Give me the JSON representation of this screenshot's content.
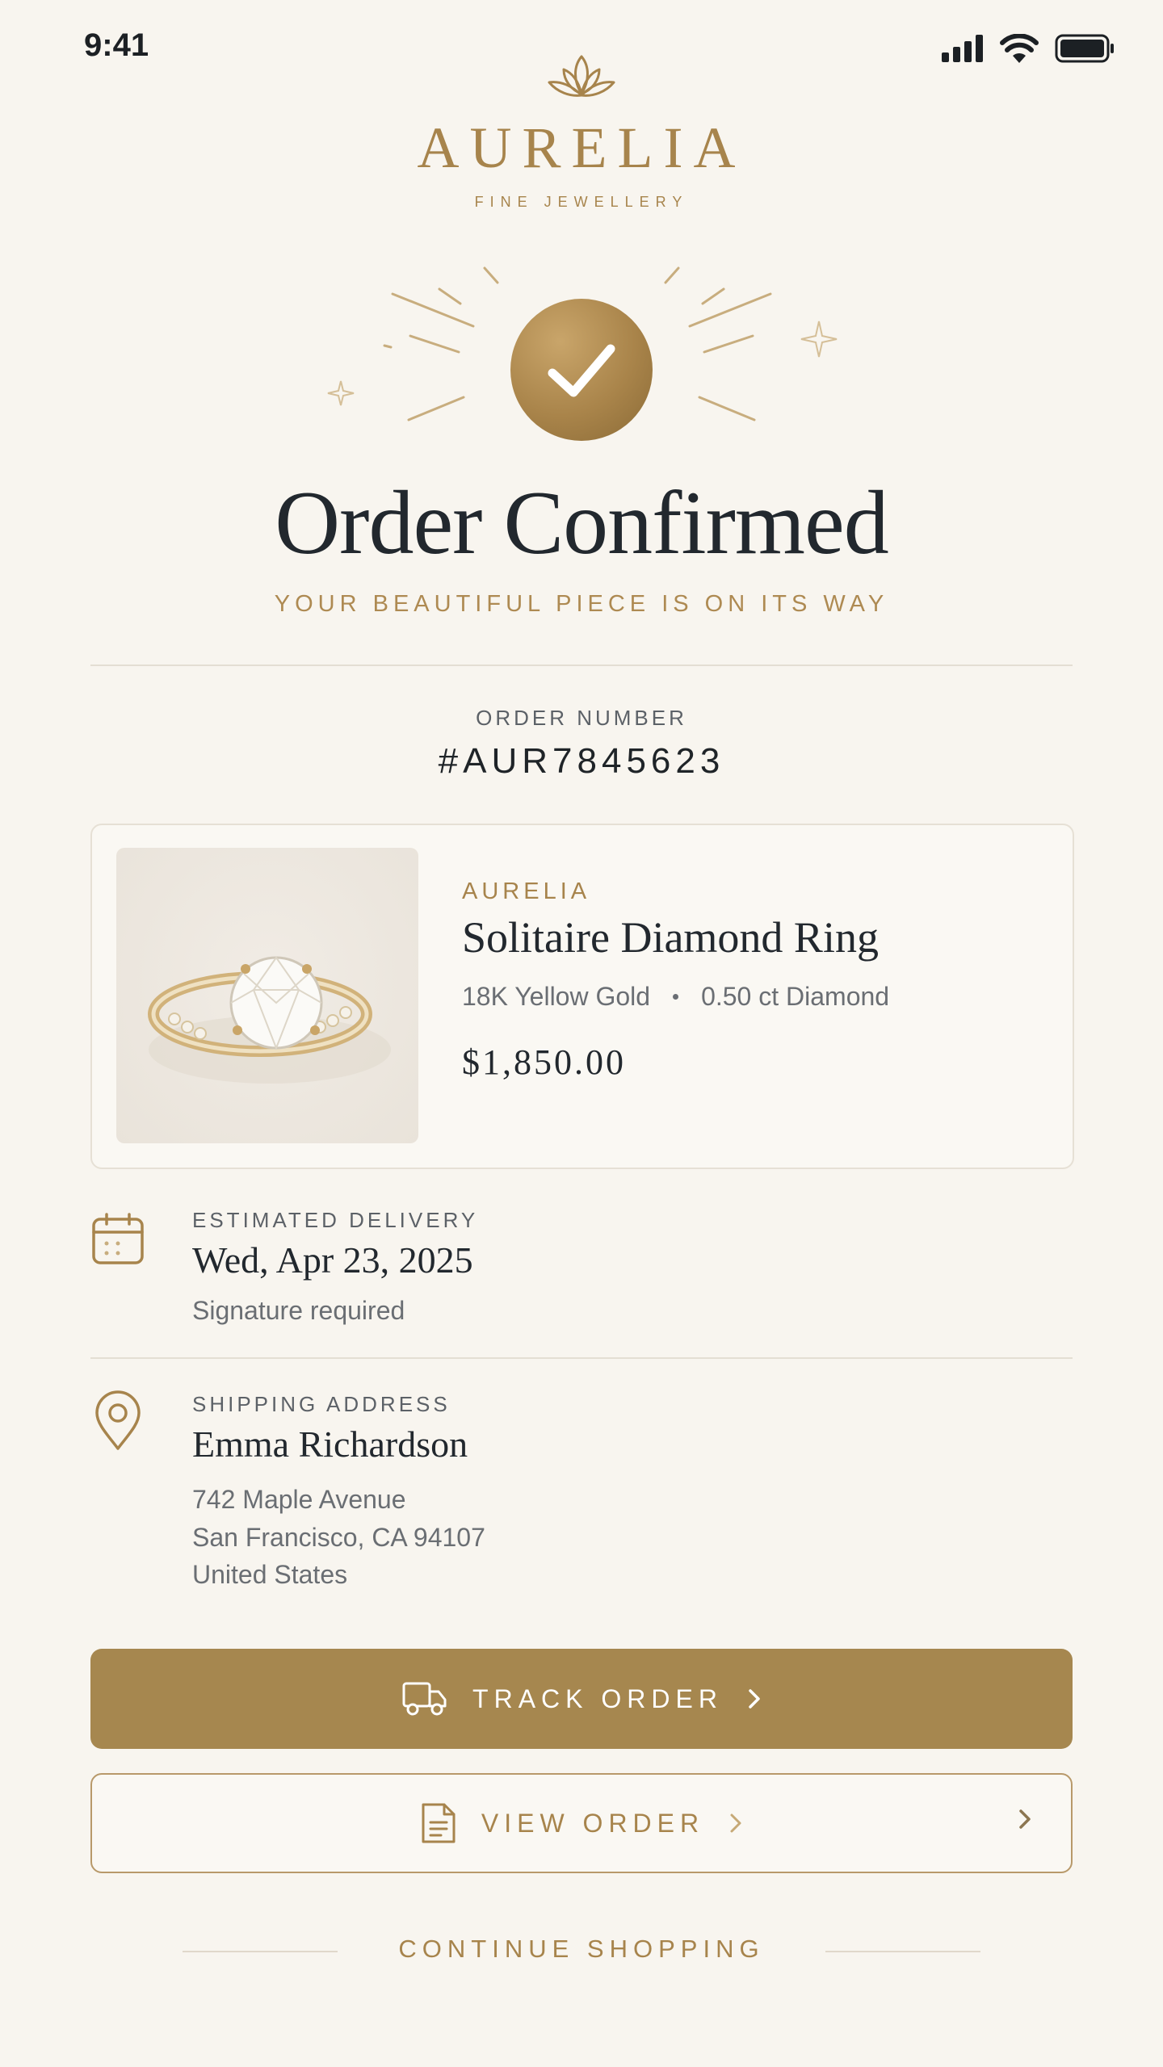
{
  "status_bar": {
    "time": "9:41"
  },
  "brand": {
    "name": "AURELIA",
    "tagline": "FINE JEWELLERY",
    "logo_icon": "lotus-icon",
    "accent_color": "#a7844c"
  },
  "confirmation": {
    "icon": "check-icon",
    "title": "Order Confirmed",
    "subtitle": "YOUR BEAUTIFUL PIECE IS ON ITS WAY"
  },
  "order": {
    "label": "ORDER NUMBER",
    "number": "#AUR7845623"
  },
  "product": {
    "brand": "AURELIA",
    "name": "Solitaire Diamond Ring",
    "metal": "18K Yellow Gold",
    "stone": "0.50 ct Diamond",
    "price": "$1,850.00",
    "image_icon": "diamond-ring-image"
  },
  "delivery": {
    "icon": "calendar-icon",
    "label": "ESTIMATED DELIVERY",
    "date": "Wed, Apr 23, 2025",
    "note": "Signature required"
  },
  "shipping": {
    "icon": "location-pin-icon",
    "label": "SHIPPING ADDRESS",
    "name": "Emma Richardson",
    "line1": "742 Maple Avenue",
    "line2": "San Francisco, CA 94107",
    "line3": "United States"
  },
  "actions": {
    "track_label": "TRACK ORDER",
    "track_icon": "truck-icon",
    "view_label": "VIEW ORDER",
    "view_icon": "document-icon",
    "continue_label": "CONTINUE SHOPPING",
    "primary_color": "#a6874f"
  }
}
